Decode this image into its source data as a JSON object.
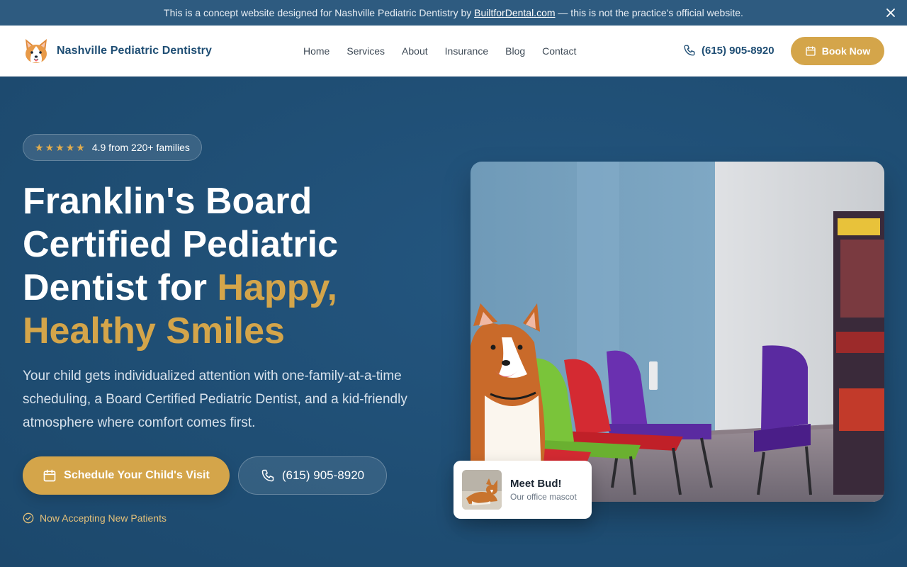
{
  "banner": {
    "text_before": "This is a concept website designed for Nashville Pediatric Dentistry by",
    "link": "BuiltforDental.com",
    "text_after": "— this is not the practice's official website."
  },
  "header": {
    "brand_name": "Nashville Pediatric Dentistry",
    "nav": [
      "Home",
      "Services",
      "About",
      "Insurance",
      "Blog",
      "Contact"
    ],
    "phone": "(615) 905-8920",
    "book_label": "Book Now"
  },
  "hero": {
    "rating_text": "4.9 from 220+ families",
    "stars": 5,
    "headline_1": "Franklin's Board",
    "headline_2": "Certified Pediatric",
    "headline_3a": "Dentist for ",
    "headline_3b": "Happy,",
    "headline_4": "Healthy Smiles",
    "lead": "Your child gets individualized attention with one-family-at-a-time scheduling, a Board Certified Pediatric Dentist, and a kid-friendly atmosphere where comfort comes first.",
    "cta_primary": "Schedule Your Child's Visit",
    "cta_phone": "(615) 905-8920",
    "accepting": "Now Accepting New Patients"
  },
  "mascot": {
    "title": "Meet Bud!",
    "subtitle": "Our office mascot"
  },
  "colors": {
    "brand_navy": "#1f4e74",
    "accent_gold": "#d4a54a",
    "banner": "#2e5b80"
  }
}
